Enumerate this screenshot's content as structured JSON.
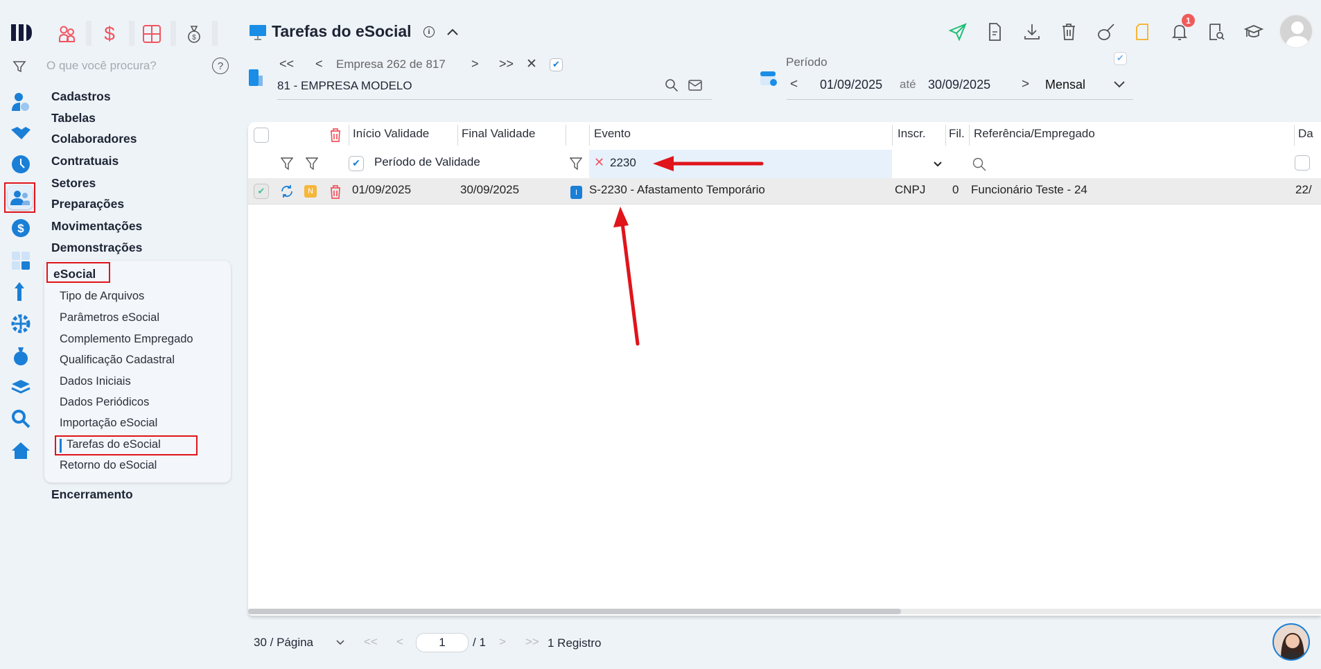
{
  "sidebar": {
    "search_placeholder": "O que você procura?",
    "menu": [
      "Cadastros",
      "Tabelas",
      "Colaboradores",
      "Contratuais",
      "Setores",
      "Preparações",
      "Movimentações",
      "Demonstrações"
    ],
    "section": "eSocial",
    "sub_items": [
      "Tipo de Arquivos",
      "Parâmetros eSocial",
      "Complemento Empregado",
      "Qualificação Cadastral",
      "Dados Iniciais",
      "Dados Periódicos",
      "Importação eSocial",
      "Tarefas do eSocial",
      "Retorno do eSocial"
    ],
    "active_sub": "Tarefas do eSocial",
    "footer_item": "Encerramento"
  },
  "header": {
    "title": "Tarefas do eSocial",
    "notification_count": "1"
  },
  "company": {
    "nav_label": "Empresa 262 de 817",
    "value": "81 - EMPRESA MODELO"
  },
  "period": {
    "label": "Período",
    "from": "01/09/2025",
    "sep": "até",
    "to": "30/09/2025",
    "mode": "Mensal"
  },
  "table": {
    "columns": [
      "Início Validade",
      "Final Validade",
      "Evento",
      "Inscr.",
      "Fil.",
      "Referência/Empregado",
      "Da"
    ],
    "filter": {
      "period_label": "Período de Validade",
      "event_value": "2230"
    },
    "rows": [
      {
        "status": "N",
        "inicio": "01/09/2025",
        "final": "30/09/2025",
        "badge": "I",
        "evento": "S-2230 - Afastamento Temporário",
        "inscr": "CNPJ",
        "fil": "0",
        "ref": "Funcionário Teste - 24",
        "da": "22/"
      }
    ]
  },
  "pagination": {
    "per_page": "30 / Página",
    "page": "1",
    "total_pages": "/ 1",
    "records": "1 Registro"
  },
  "colors": {
    "accent": "#1a7fd6",
    "annotation": "#e0141b",
    "send": "#1dbf73",
    "warning": "#f6b73c"
  }
}
